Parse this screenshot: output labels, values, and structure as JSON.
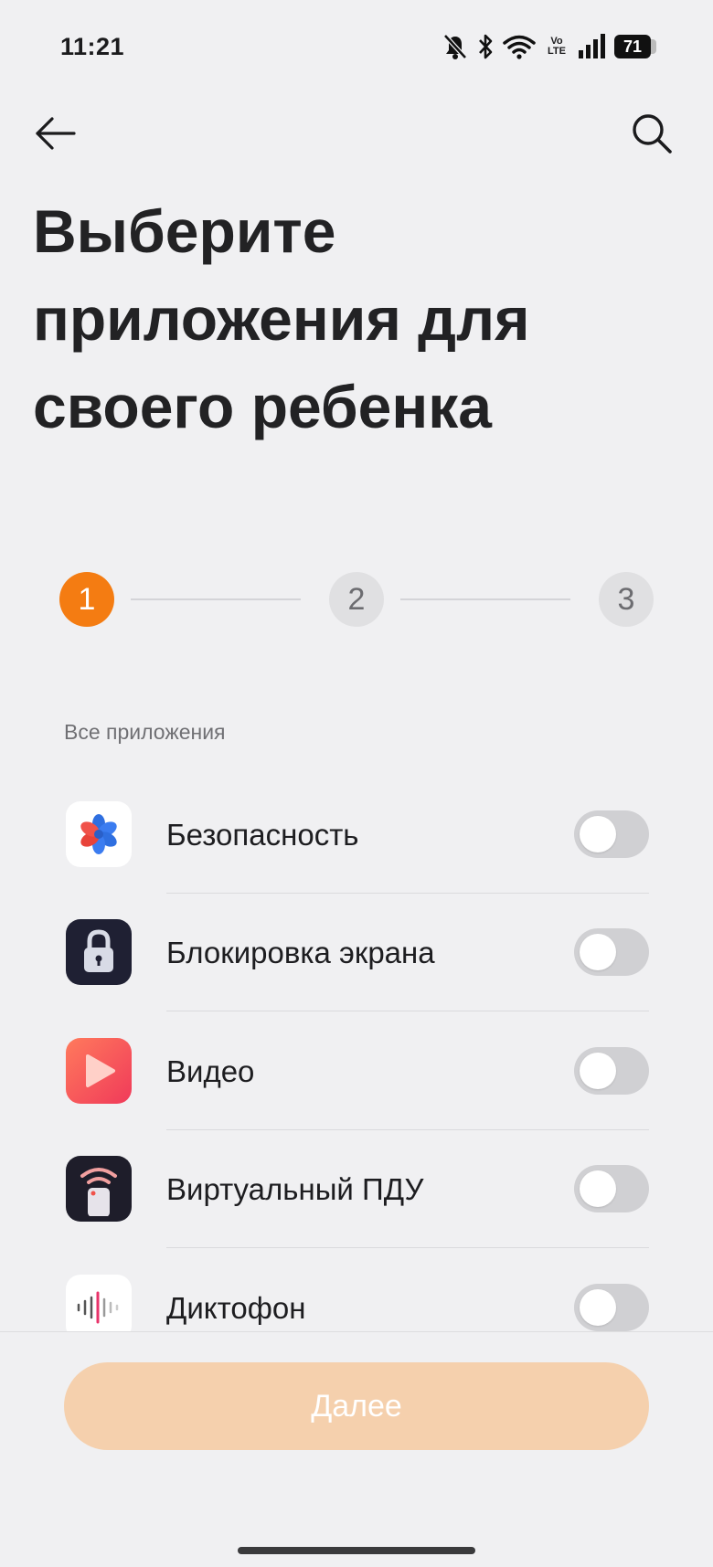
{
  "status_bar": {
    "time": "11:21",
    "network_badge_top": "Vo",
    "network_badge_bottom": "LTE",
    "battery": "71"
  },
  "header": {
    "back_icon": "arrow-left-icon",
    "search_icon": "search-icon",
    "title": "Выберите приложения для своего ребенка"
  },
  "stepper": {
    "current_step": 1,
    "steps": [
      "1",
      "2",
      "3"
    ],
    "active_color": "#f47c12"
  },
  "section": {
    "label": "Все приложения"
  },
  "apps": [
    {
      "name": "Безопасность",
      "icon": "security-app-icon",
      "enabled": false
    },
    {
      "name": "Блокировка экрана",
      "icon": "lock-screen-app-icon",
      "enabled": false
    },
    {
      "name": "Видео",
      "icon": "video-app-icon",
      "enabled": false
    },
    {
      "name": "Виртуальный ПДУ",
      "icon": "virtual-remote-app-icon",
      "enabled": false
    },
    {
      "name": "Диктофон",
      "icon": "recorder-app-icon",
      "enabled": false
    }
  ],
  "footer": {
    "next_label": "Далее",
    "next_enabled": false,
    "button_color": "#f5d0ad"
  }
}
